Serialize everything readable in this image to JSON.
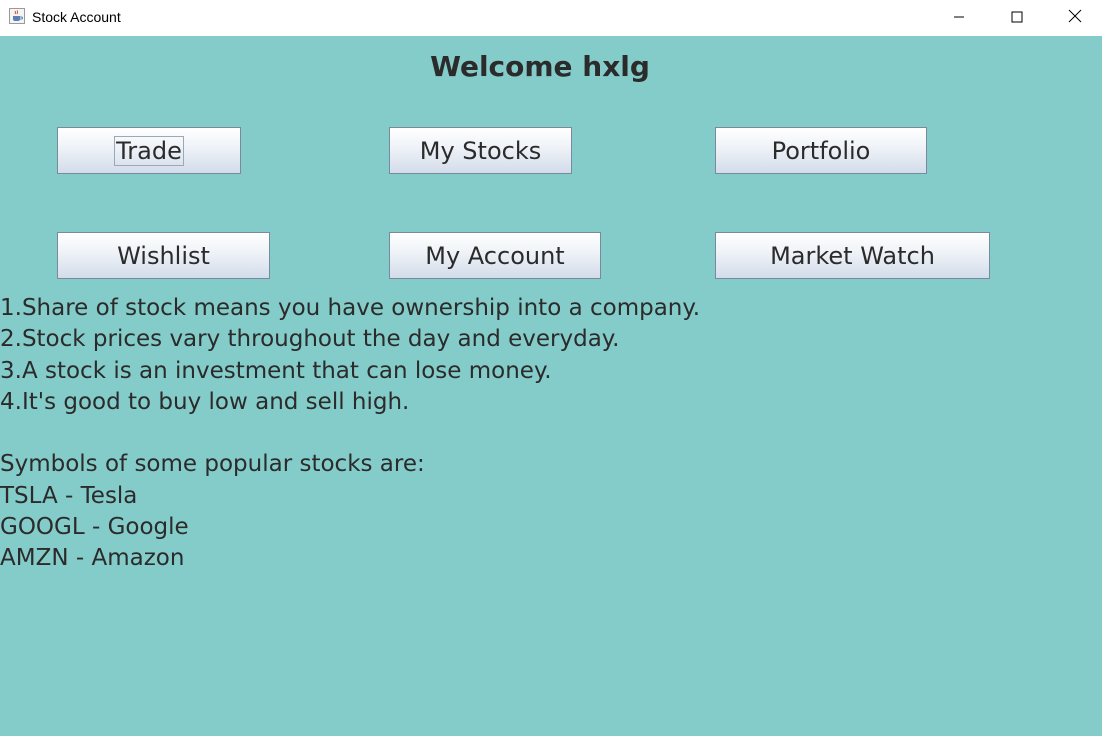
{
  "window": {
    "title": "Stock Account",
    "controls": {
      "minimize_icon": "minimize-icon",
      "maximize_icon": "maximize-icon",
      "close_icon": "close-icon"
    }
  },
  "main": {
    "welcome": "Welcome hxlg",
    "buttons": {
      "trade": "Trade",
      "my_stocks": "My Stocks",
      "portfolio": "Portfolio",
      "wishlist": "Wishlist",
      "my_account": "My Account",
      "market_watch": "Market Watch"
    },
    "tips": [
      "1.Share of stock means you have ownership into a company.",
      "2.Stock prices vary throughout the day and everyday.",
      "3.A stock is an investment that can lose money.",
      "4.It's good to buy low and sell high."
    ],
    "symbols_heading": "Symbols of some popular stocks are:",
    "symbols": [
      "TSLA - Tesla",
      "GOOGL - Google",
      "AMZN - Amazon"
    ]
  },
  "colors": {
    "background": "#84ccc9",
    "text": "#2b2b2b",
    "titlebar": "#ffffff"
  }
}
